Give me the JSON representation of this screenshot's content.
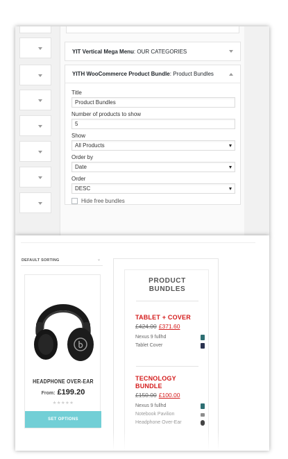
{
  "admin": {
    "widgets": [
      {
        "name": "YIT Vertical Mega Menu",
        "title": "OUR CATEGORIES",
        "expanded": false
      },
      {
        "name": "YITH WooCommerce Product Bundle",
        "title": "Product Bundles",
        "expanded": true
      }
    ],
    "form": {
      "title_label": "Title",
      "title_value": "Product Bundles",
      "count_label": "Number of products to show",
      "count_value": "5",
      "show_label": "Show",
      "show_value": "All Products",
      "orderby_label": "Order by",
      "orderby_value": "Date",
      "order_label": "Order",
      "order_value": "DESC",
      "hide_free_label": "Hide free bundles"
    }
  },
  "store": {
    "sorting_label": "DEFAULT SORTING",
    "product": {
      "name": "HEADPHONE OVER-EAR",
      "price_prefix": "From:",
      "price": "£199.20",
      "rating_stars": "★★★★★",
      "button_label": "SET OPTIONS"
    },
    "widget_title_line1": "PRODUCT",
    "widget_title_line2": "BUNDLES",
    "bundles": [
      {
        "name": "TABLET + COVER",
        "old_price": "£424.00",
        "new_price": "£371.60",
        "items": [
          {
            "name": "Nexus 9 fullhd",
            "thumb_icon": "tablet-thumb-icon",
            "thumb_color": "#2e6f73"
          },
          {
            "name": "Tablet Cover",
            "thumb_icon": "cover-thumb-icon",
            "thumb_color": "#2a3350"
          }
        ]
      },
      {
        "name_line1": "TECNOLOGY",
        "name_line2": "BUNDLE",
        "old_price": "£150.00",
        "new_price": "£100.00",
        "items": [
          {
            "name": "Nexus 9 fullhd",
            "thumb_icon": "tablet-thumb-icon",
            "thumb_color": "#2e6f73"
          },
          {
            "name": "Notebook Pavilion",
            "thumb_icon": "notebook-thumb-icon",
            "thumb_color": "#8d8d8d"
          },
          {
            "name": "Headphone Over-Ear",
            "thumb_icon": "headphone-thumb-icon",
            "thumb_color": "#444444"
          }
        ]
      }
    ]
  }
}
